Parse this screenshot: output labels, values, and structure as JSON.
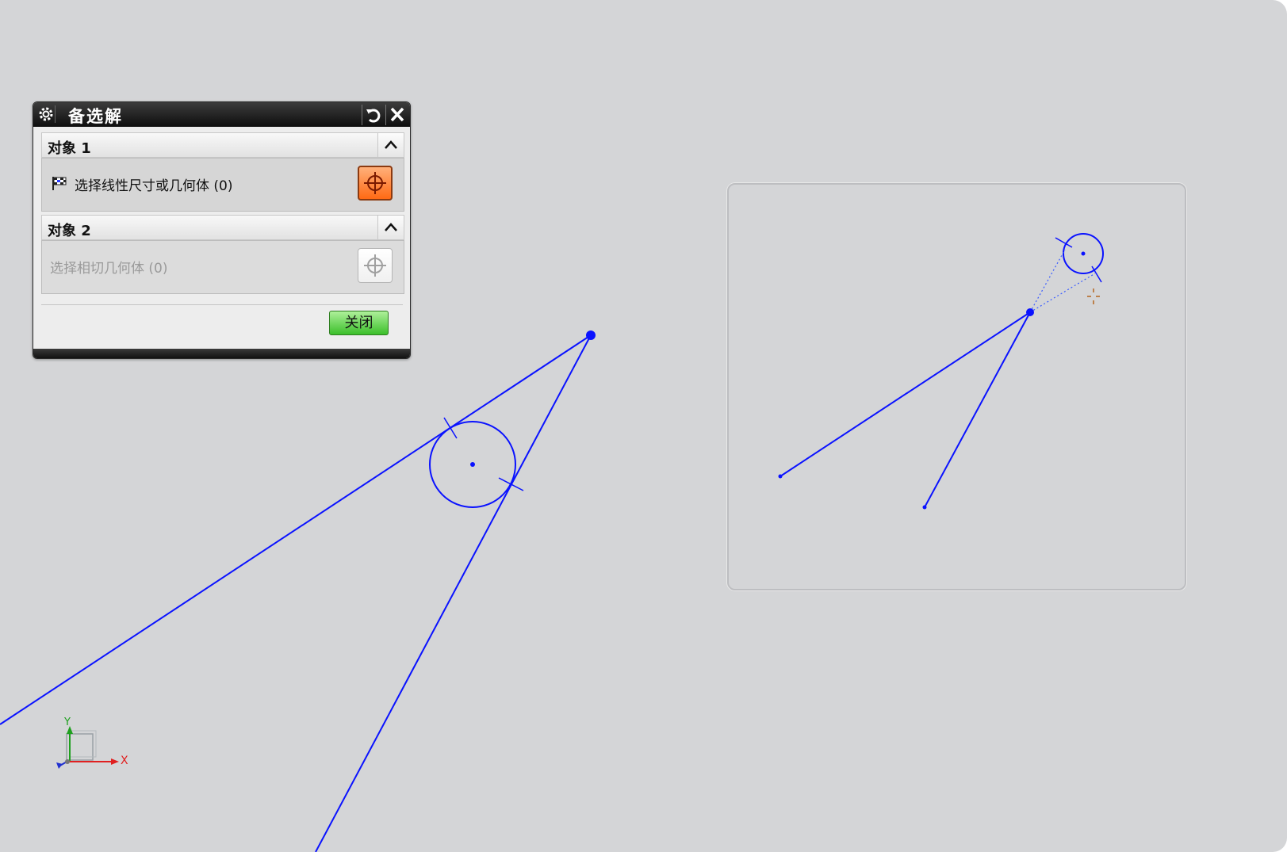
{
  "dialog": {
    "title": "备选解",
    "section1": {
      "header": "对象 1",
      "prompt": "选择线性尺寸或几何体 (0)"
    },
    "section2": {
      "header": "对象 2",
      "prompt": "选择相切几何体 (0)"
    },
    "close_label": "关闭"
  },
  "triad": {
    "x_label": "X",
    "y_label": "Y"
  },
  "colors": {
    "sketch_line": "#0a12ff",
    "preview_hint": "#b5651d",
    "active_select": "#ff6a14",
    "close_button": "#3bbf2a"
  }
}
